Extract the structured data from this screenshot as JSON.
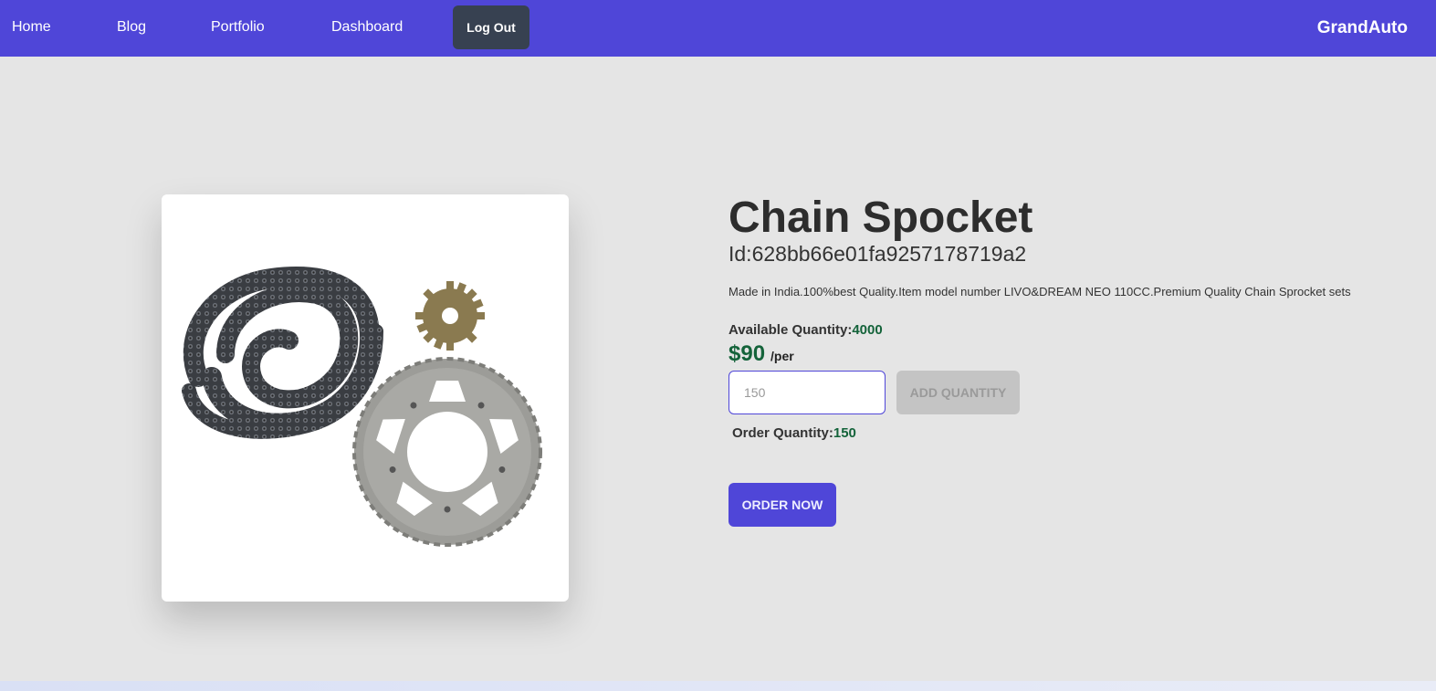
{
  "nav": {
    "links": [
      "Home",
      "Blog",
      "Portfolio",
      "Dashboard"
    ],
    "logout_label": "Log Out",
    "brand": "GrandAuto"
  },
  "product": {
    "title": "Chain Spocket",
    "id_text": "Id:628bb66e01fa9257178719a2",
    "description": "Made in India.100%best Quality.Item model number LIVO&DREAM NEO 110CC.Premium Quality Chain Sprocket sets",
    "available_label": "Available Quantity:",
    "available_value": "4000",
    "price": "$90",
    "per": "/per",
    "qty_placeholder": "150",
    "add_qty_label": "ADD QUANTITY",
    "order_qty_label": "Order Quantity:",
    "order_qty_value": "150",
    "order_label": "ORDER NOW"
  },
  "colors": {
    "primary": "#4f46d8",
    "logout_bg": "#374151",
    "price_green": "#14633a",
    "background": "#e5e5e5"
  }
}
